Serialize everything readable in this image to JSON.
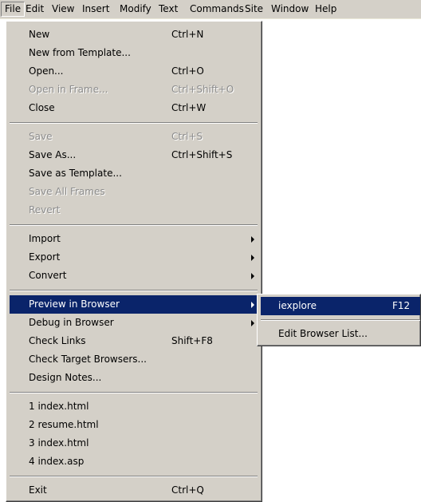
{
  "menubar": {
    "file": "File",
    "edit": "Edit",
    "view": "View",
    "insert": "Insert",
    "modify": "Modify",
    "text": "Text",
    "commands": "Commands",
    "site": "Site",
    "window": "Window",
    "help": "Help"
  },
  "file_menu": {
    "new": {
      "label": "New",
      "shortcut": "Ctrl+N"
    },
    "new_from_template": {
      "label": "New from Template..."
    },
    "open": {
      "label": "Open...",
      "shortcut": "Ctrl+O"
    },
    "open_in_frame": {
      "label": "Open in Frame...",
      "shortcut": "Ctrl+Shift+O"
    },
    "close": {
      "label": "Close",
      "shortcut": "Ctrl+W"
    },
    "save": {
      "label": "Save",
      "shortcut": "Ctrl+S"
    },
    "save_as": {
      "label": "Save As...",
      "shortcut": "Ctrl+Shift+S"
    },
    "save_as_template": {
      "label": "Save as Template..."
    },
    "save_all_frames": {
      "label": "Save All Frames"
    },
    "revert": {
      "label": "Revert"
    },
    "import": {
      "label": "Import"
    },
    "export": {
      "label": "Export"
    },
    "convert": {
      "label": "Convert"
    },
    "preview_in_browser": {
      "label": "Preview in Browser"
    },
    "debug_in_browser": {
      "label": "Debug in Browser"
    },
    "check_links": {
      "label": "Check Links",
      "shortcut": "Shift+F8"
    },
    "check_target_browsers": {
      "label": "Check Target Browsers..."
    },
    "design_notes": {
      "label": "Design Notes..."
    },
    "recent": [
      "1 index.html",
      "2 resume.html",
      "3 index.html",
      "4 index.asp"
    ],
    "exit": {
      "label": "Exit",
      "shortcut": "Ctrl+Q"
    }
  },
  "preview_submenu": {
    "iexplore": {
      "label": "iexplore",
      "shortcut": "F12"
    },
    "edit_browser_list": {
      "label": "Edit Browser List..."
    }
  }
}
